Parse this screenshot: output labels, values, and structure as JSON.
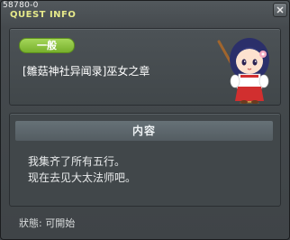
{
  "window": {
    "quest_id": "58780-0",
    "title": "QUEST INFO"
  },
  "quest": {
    "category": "一般",
    "name": "[雛菇神社异闻录]巫女之章"
  },
  "content": {
    "header": "内容",
    "lines": [
      "我集齐了所有五行。",
      "现在去见大太法师吧。"
    ]
  },
  "status": {
    "text": "狀態: 可開始"
  },
  "icons": {
    "close": "close-icon",
    "character": "shrine-maiden-avatar"
  },
  "colors": {
    "title_text": "#e6e98a",
    "badge": "#8cc541",
    "content_header": "#5c666b"
  }
}
